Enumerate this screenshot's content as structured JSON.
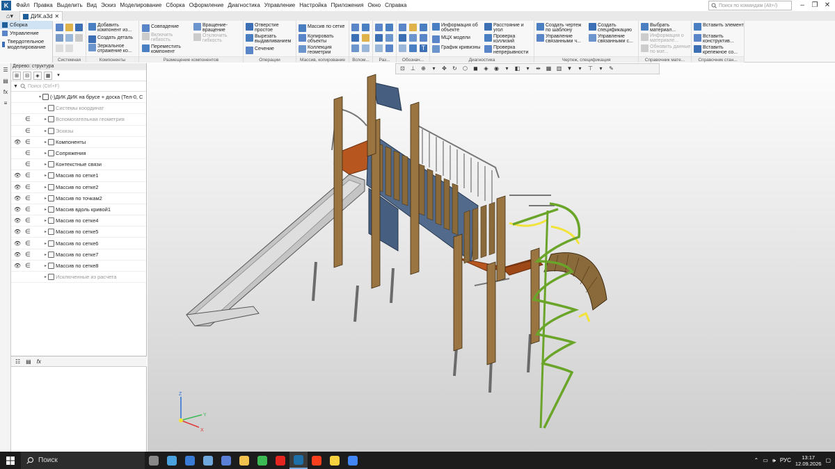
{
  "menubar": {
    "items": [
      "Файл",
      "Правка",
      "Выделить",
      "Вид",
      "Эскиз",
      "Моделирование",
      "Сборка",
      "Оформление",
      "Диагностика",
      "Управление",
      "Настройка",
      "Приложения",
      "Окно",
      "Справка"
    ],
    "search_placeholder": "Поиск по командам (Alt+/)"
  },
  "tabbar": {
    "doc_tab": "ДИК.a3d"
  },
  "modes": {
    "items": [
      "Сборка",
      "Управление",
      "Твердотельное моделирование"
    ]
  },
  "ribbon": {
    "groups": {
      "system": "Системная",
      "components": "Компоненты",
      "placement": "Размещение компонентов",
      "operations": "Операции",
      "array": "Массив, копирование",
      "aux": "Вспом...",
      "sizes": "Раз...",
      "designations": "Обознач...",
      "diagnostics": "Диагностика",
      "drawing_spec": "Чертеж, спецификация",
      "materials_ref": "Справочник мате...",
      "standard_ref": "Справочник стан..."
    },
    "buttons": {
      "add_component": "Добавить компонент из...",
      "create_part": "Создать деталь",
      "mirror_component": "Зеркальное отражение ко...",
      "coincidence": "Совпадение",
      "enable_flex": "Включить гибкость",
      "move_component": "Переместить компонент",
      "rotation": "Вращение-вращение",
      "disable_flex": "Отключить гибкость",
      "hole_simple": "Отверстие простое",
      "cut_extrude": "Вырезать выдавливанием",
      "section": "Сечение",
      "grid_array": "Массив по сетке",
      "copy_objects": "Копировать объекты",
      "geometry_collection": "Коллекция геометрии",
      "object_info": "Информация об объекте",
      "mcx": "МЦХ модели",
      "curvature_graph": "График кривизны",
      "distance_angle": "Расстояние и угол",
      "check_collisions": "Проверка коллизий",
      "check_continuity": "Проверка непрерывности",
      "create_drawing": "Создать чертеж по шаблону",
      "manage_linked": "Управление связанными ч...",
      "create_spec": "Создать спецификацию",
      "manage_linked_spec": "Управление связанными с...",
      "choose_material": "Выбрать материал...",
      "material_info": "Информация о материале...",
      "update_material": "Обновить данные по мат...",
      "insert_element": "Вставить элемент",
      "insert_construction": "Вставить конструктив...",
      "insert_fastener": "Вставить крепежное со..."
    }
  },
  "tree": {
    "title": "Дерево: структура",
    "filter_placeholder": "Поиск (Ctrl+F)",
    "root": "(-)ДИК  ДИК на брусе + доска (Тел-0, С",
    "rows": [
      {
        "label": "Системы координат",
        "dim": true,
        "eye": false,
        "eps": false
      },
      {
        "label": "Вспомогательная геометрия",
        "dim": true,
        "eye": false,
        "eps": true
      },
      {
        "label": "Эскизы",
        "dim": true,
        "eye": false,
        "eps": true
      },
      {
        "label": "Компоненты",
        "dim": false,
        "eye": true,
        "eps": true
      },
      {
        "label": "Сопряжения",
        "dim": false,
        "eye": false,
        "eps": true
      },
      {
        "label": "Контекстные связи",
        "dim": false,
        "eye": false,
        "eps": true
      },
      {
        "label": "Массив по сетке1",
        "dim": false,
        "eye": true,
        "eps": true
      },
      {
        "label": "Массив по сетке2",
        "dim": false,
        "eye": true,
        "eps": true
      },
      {
        "label": "Массив по точкам2",
        "dim": false,
        "eye": true,
        "eps": true
      },
      {
        "label": "Массив вдоль кривой1",
        "dim": false,
        "eye": true,
        "eps": true
      },
      {
        "label": "Массив по сетке4",
        "dim": false,
        "eye": true,
        "eps": true
      },
      {
        "label": "Массив по сетке5",
        "dim": false,
        "eye": true,
        "eps": true
      },
      {
        "label": "Массив по сетке6",
        "dim": false,
        "eye": true,
        "eps": true
      },
      {
        "label": "Массив по сетке7",
        "dim": false,
        "eye": true,
        "eps": true
      },
      {
        "label": "Массив по сетке8",
        "dim": false,
        "eye": true,
        "eps": true
      },
      {
        "label": "Исключенные из расчета",
        "dim": true,
        "eye": false,
        "eps": false
      }
    ]
  },
  "triad": {
    "x": "X",
    "y": "Y",
    "z": "Z"
  },
  "taskbar": {
    "search": "Поиск",
    "lang": "РУС",
    "time": "13:17",
    "date": "12.09.2026",
    "apps": [
      {
        "name": "task-view",
        "color": "#888888"
      },
      {
        "name": "app-explorer-blue",
        "color": "#4aa3df"
      },
      {
        "name": "app-note",
        "color": "#3a7bd5"
      },
      {
        "name": "app-mail",
        "color": "#6fa8dc"
      },
      {
        "name": "app-save",
        "color": "#5b7fd6"
      },
      {
        "name": "app-folder",
        "color": "#f2c14e"
      },
      {
        "name": "app-chrome",
        "color": "#3cba54"
      },
      {
        "name": "app-yandex",
        "color": "#e52620"
      },
      {
        "name": "app-kompas",
        "color": "#1f6fa8"
      },
      {
        "name": "app-yandex-browser",
        "color": "#fc3f1d"
      },
      {
        "name": "app-sun",
        "color": "#f7d23e"
      },
      {
        "name": "app-chrome-2",
        "color": "#4285f4"
      }
    ]
  },
  "colors": {
    "accent": "#1f5f99",
    "wood": "#8a6a3a",
    "panel_blue": "#465e80",
    "orange_deck": "#b8561f",
    "green_rail": "#6aa52a",
    "yellow": "#f2e33a"
  }
}
